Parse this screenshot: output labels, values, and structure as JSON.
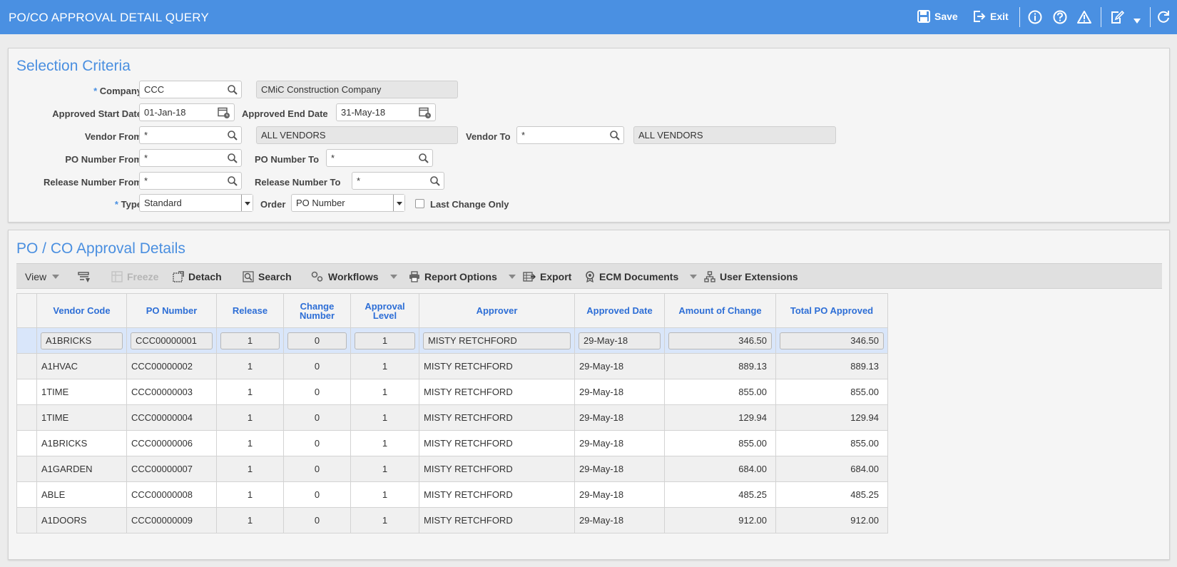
{
  "window": {
    "title": "PO/CO APPROVAL DETAIL QUERY"
  },
  "titlebar": {
    "save_label": "Save",
    "exit_label": "Exit"
  },
  "selection": {
    "title": "Selection Criteria",
    "company_label": "Company",
    "company_value": "CCC",
    "company_name": "CMiC Construction Company",
    "start_date_label": "Approved Start Date",
    "start_date_value": "01-Jan-18",
    "end_date_label": "Approved End Date",
    "end_date_value": "31-May-18",
    "vendor_from_label": "Vendor From",
    "vendor_from_value": "*",
    "vendor_from_name": "ALL VENDORS",
    "vendor_to_label": "Vendor To",
    "vendor_to_value": "*",
    "vendor_to_name": "ALL VENDORS",
    "po_from_label": "PO Number From",
    "po_from_value": "*",
    "po_to_label": "PO Number To",
    "po_to_value": "*",
    "release_from_label": "Release Number From",
    "release_from_value": "*",
    "release_to_label": "Release Number To",
    "release_to_value": "*",
    "type_label": "Type",
    "type_value": "Standard",
    "order_label": "Order",
    "order_value": "PO Number",
    "last_change_label": "Last Change Only",
    "required_mark": "*"
  },
  "details": {
    "title": "PO / CO Approval Details",
    "toolbar": {
      "view": "View",
      "freeze": "Freeze",
      "detach": "Detach",
      "search": "Search",
      "workflows": "Workflows",
      "report_options": "Report Options",
      "export": "Export",
      "ecm_documents": "ECM Documents",
      "user_extensions": "User Extensions"
    },
    "columns": {
      "vendor_code": "Vendor Code",
      "po_number": "PO Number",
      "release": "Release",
      "change_number_1": "Change",
      "change_number_2": "Number",
      "approval_level_1": "Approval",
      "approval_level_2": "Level",
      "approver": "Approver",
      "approved_date": "Approved Date",
      "amount_of_change": "Amount of Change",
      "total_po_approved": "Total PO Approved"
    },
    "rows": [
      {
        "vendor": "A1BRICKS",
        "po": "CCC00000001",
        "release": "1",
        "change": "0",
        "level": "1",
        "approver": "MISTY RETCHFORD",
        "date": "29-May-18",
        "amount": "346.50",
        "total": "346.50"
      },
      {
        "vendor": "A1HVAC",
        "po": "CCC00000002",
        "release": "1",
        "change": "0",
        "level": "1",
        "approver": "MISTY RETCHFORD",
        "date": "29-May-18",
        "amount": "889.13",
        "total": "889.13"
      },
      {
        "vendor": "1TIME",
        "po": "CCC00000003",
        "release": "1",
        "change": "0",
        "level": "1",
        "approver": "MISTY RETCHFORD",
        "date": "29-May-18",
        "amount": "855.00",
        "total": "855.00"
      },
      {
        "vendor": "1TIME",
        "po": "CCC00000004",
        "release": "1",
        "change": "0",
        "level": "1",
        "approver": "MISTY RETCHFORD",
        "date": "29-May-18",
        "amount": "129.94",
        "total": "129.94"
      },
      {
        "vendor": "A1BRICKS",
        "po": "CCC00000006",
        "release": "1",
        "change": "0",
        "level": "1",
        "approver": "MISTY RETCHFORD",
        "date": "29-May-18",
        "amount": "855.00",
        "total": "855.00"
      },
      {
        "vendor": "A1GARDEN",
        "po": "CCC00000007",
        "release": "1",
        "change": "0",
        "level": "1",
        "approver": "MISTY RETCHFORD",
        "date": "29-May-18",
        "amount": "684.00",
        "total": "684.00"
      },
      {
        "vendor": "ABLE",
        "po": "CCC00000008",
        "release": "1",
        "change": "0",
        "level": "1",
        "approver": "MISTY RETCHFORD",
        "date": "29-May-18",
        "amount": "485.25",
        "total": "485.25"
      },
      {
        "vendor": "A1DOORS",
        "po": "CCC00000009",
        "release": "1",
        "change": "0",
        "level": "1",
        "approver": "MISTY RETCHFORD",
        "date": "29-May-18",
        "amount": "912.00",
        "total": "912.00"
      }
    ]
  },
  "icons": {
    "save": "floppy-disk-icon",
    "exit": "exit-icon",
    "info": "info-icon",
    "help": "help-icon",
    "warning": "warning-icon",
    "edit": "edit-icon",
    "refresh": "refresh-icon",
    "search": "magnifier-icon",
    "calendar": "calendar-icon"
  },
  "colors": {
    "accent": "#4a90e2",
    "selected_row": "#d9e6fa",
    "header_text": "#2d6ed6"
  }
}
